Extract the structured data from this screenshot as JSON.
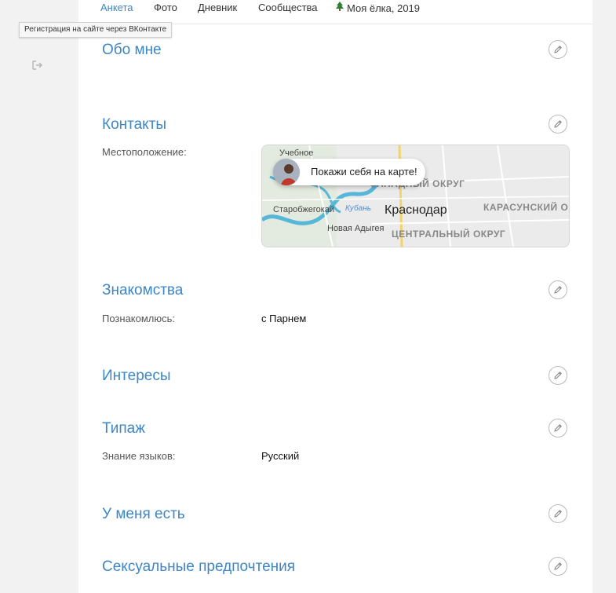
{
  "tabs": [
    {
      "label": "Анкета",
      "active": true
    },
    {
      "label": "Фото"
    },
    {
      "label": "Дневник"
    },
    {
      "label": "Сообщества"
    },
    {
      "label": "Моя ёлка, 2019",
      "icon": "christmas-tree-icon"
    }
  ],
  "tooltip": "Регистрация на сайте через ВКонтакте",
  "sidebar": {
    "logout_icon": "logout-arrow-icon"
  },
  "sections": {
    "about": {
      "title": "Обо мне"
    },
    "contacts": {
      "title": "Контакты",
      "location_label": "Местоположение:",
      "map": {
        "popup_text": "Покажи себя на карте!",
        "city": "Краснодар",
        "places": [
          "Учебное",
          "Старобжегокай",
          "Кубань",
          "Новая Адыгея"
        ],
        "districts": [
          "ЗАПАДНЫЙ ОКРУГ",
          "КАРАСУНСКИЙ ОКРУГ",
          "ЦЕНТРАЛЬНЫЙ ОКРУГ"
        ]
      }
    },
    "dating": {
      "title": "Знакомства",
      "label": "Познакомлюсь:",
      "value": "с Парнем"
    },
    "interests": {
      "title": "Интересы"
    },
    "type": {
      "title": "Типаж",
      "label": "Знание языков:",
      "value": "Русский"
    },
    "have": {
      "title": "У меня есть"
    },
    "sexual": {
      "title": "Сексуальные предпочтения"
    }
  },
  "colors": {
    "accent": "#3d86c6",
    "background": "#f2f2f2",
    "card": "#ffffff"
  }
}
